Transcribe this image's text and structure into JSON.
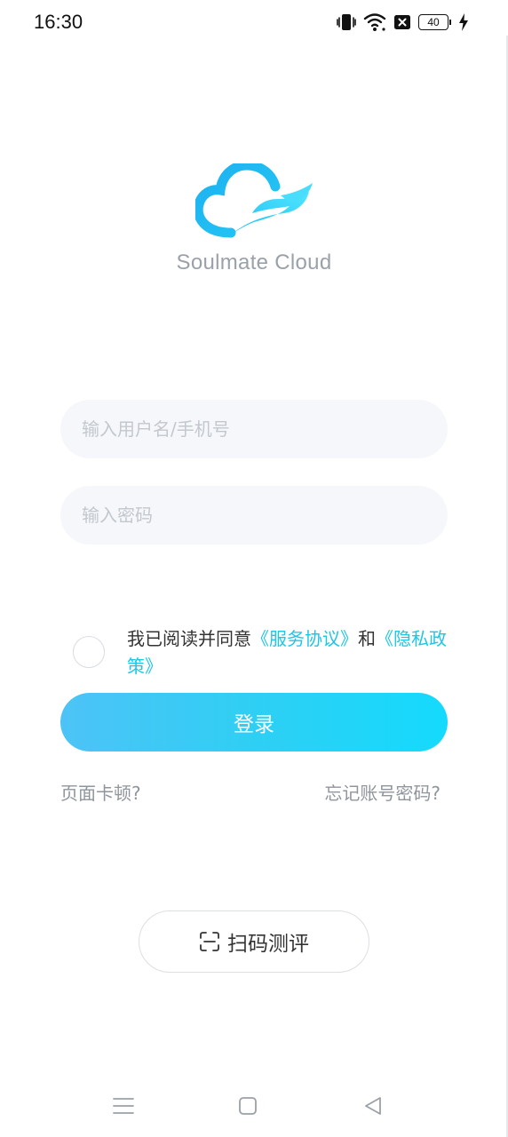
{
  "status_bar": {
    "time": "16:30",
    "battery_level": "40"
  },
  "brand": {
    "name": "Soulmate Cloud",
    "logo_colors": [
      "#1db0f0",
      "#3ee0ff"
    ]
  },
  "login_form": {
    "username_placeholder": "输入用户名/手机号",
    "password_placeholder": "输入密码"
  },
  "agreement": {
    "text_prefix": "我已阅读并同意",
    "service_link": "《服务协议》",
    "conjunction": "和",
    "privacy_link": "《隐私政策》"
  },
  "buttons": {
    "login_label": "登录",
    "page_stuck_label": "页面卡顿?",
    "forgot_label": "忘记账号密码?",
    "scan_label": "扫码测评"
  },
  "colors": {
    "accent": "#1ec6e6",
    "button_gradient_start": "#4dc3f6",
    "button_gradient_end": "#14dafd"
  },
  "icons": {
    "vibrate": "vibrate-icon",
    "wifi": "wifi-icon",
    "sim_off": "sim-off-icon",
    "charging": "charging-bolt-icon",
    "scan": "scan-icon",
    "nav_menu": "menu-icon",
    "nav_home": "home-square-icon",
    "nav_back": "back-triangle-icon"
  }
}
